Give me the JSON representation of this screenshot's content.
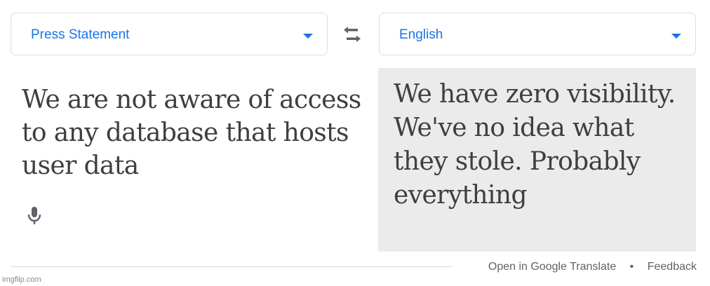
{
  "source_language": {
    "label": "Press Statement",
    "icon": "chevron-down-icon"
  },
  "target_language": {
    "label": "English",
    "icon": "chevron-down-icon"
  },
  "swap": {
    "icon": "swap-horiz-icon"
  },
  "source_panel": {
    "text": "We are not aware of access to any database that hosts user data",
    "mic_icon": "microphone-icon"
  },
  "target_panel": {
    "text": "We have zero visibility. We've no idea what they stole. Probably everything"
  },
  "footer": {
    "open_link": "Open in Google Translate",
    "separator": "•",
    "feedback_link": "Feedback"
  },
  "watermark": "imgflip.com",
  "colors": {
    "accent": "#1a73e8",
    "text": "#3c4043",
    "muted": "#5f6368",
    "target_bg": "#ebebeb",
    "border": "#dadce0"
  }
}
